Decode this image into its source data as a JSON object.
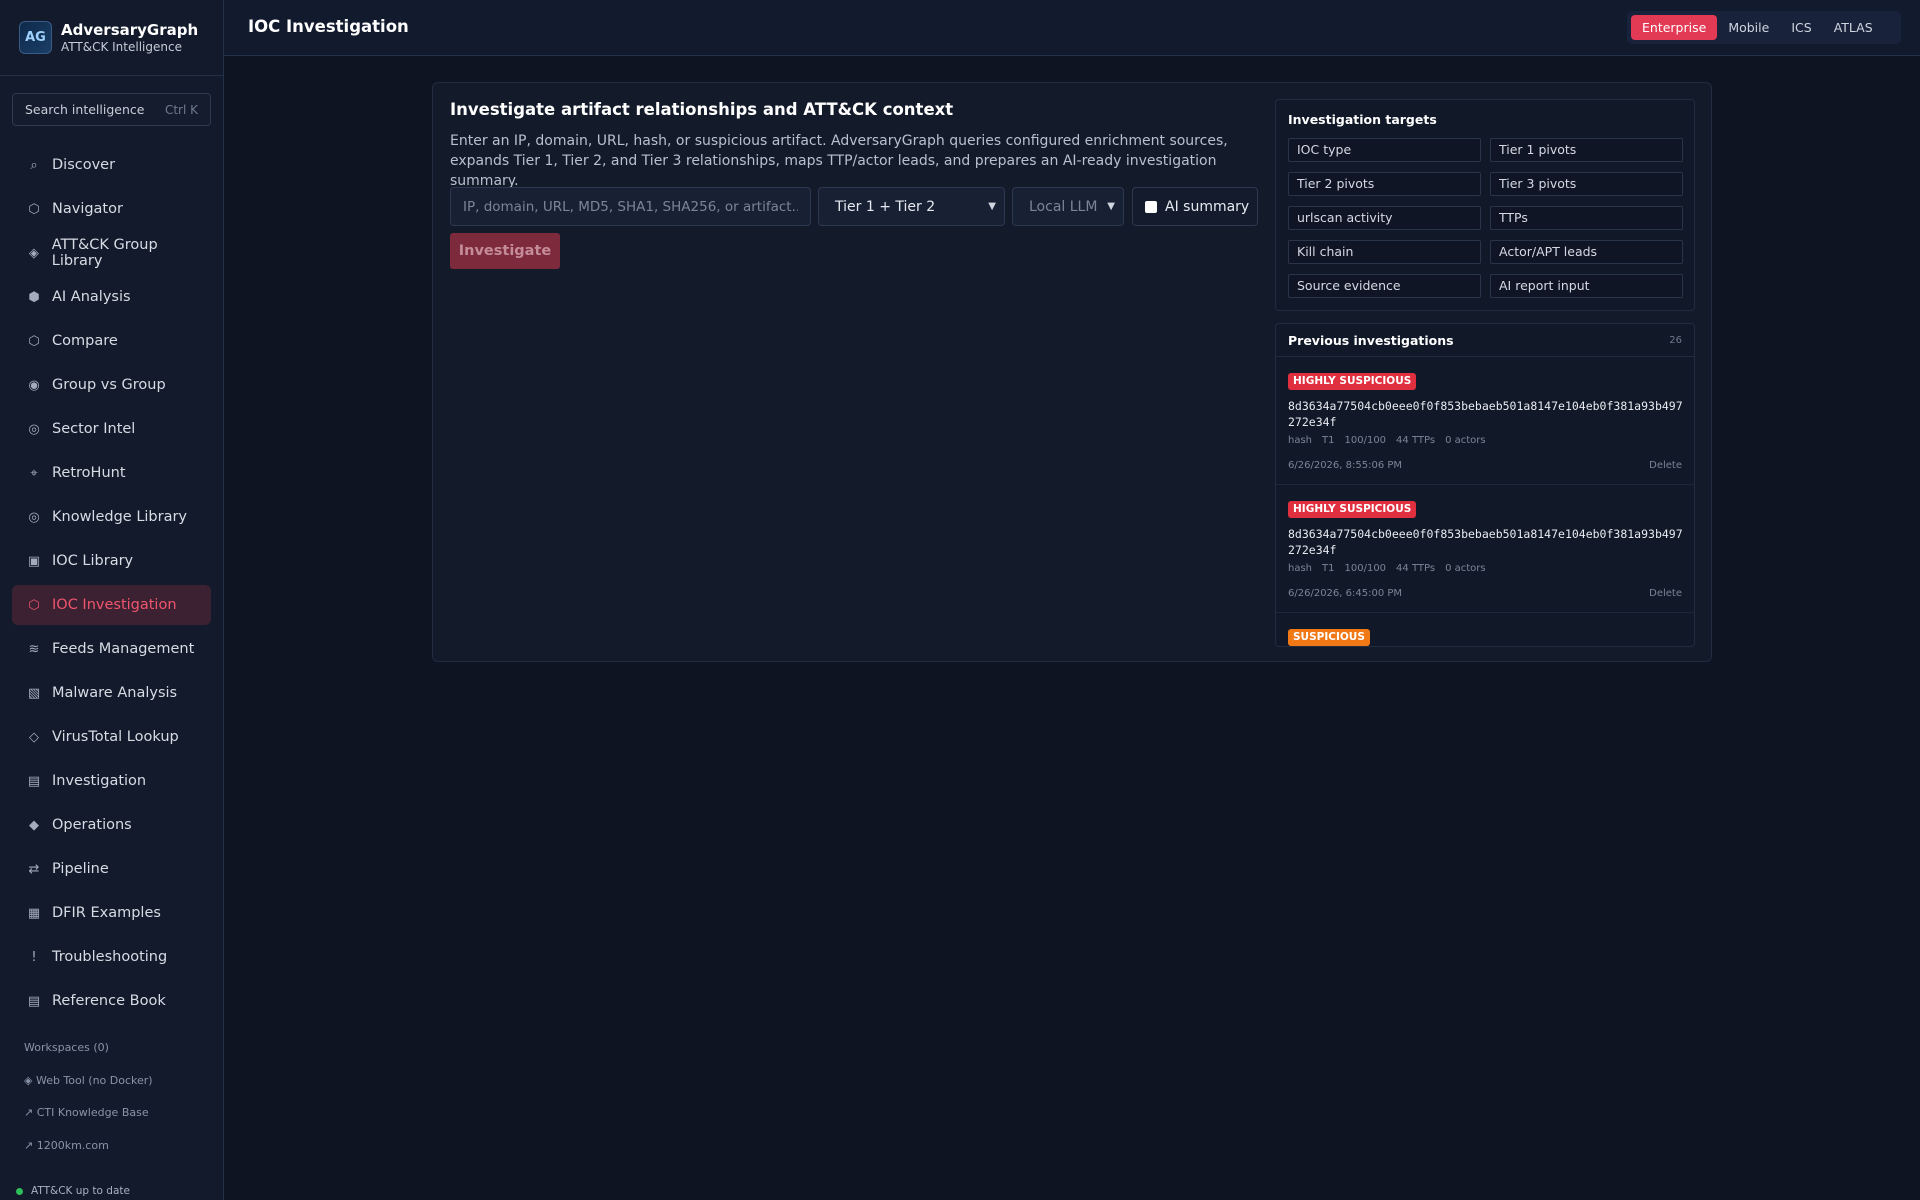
{
  "brand": {
    "logo": "AG",
    "name": "AdversaryGraph",
    "subtitle": "ATT&CK Intelligence"
  },
  "search": {
    "placeholder": "Search intelligence",
    "shortcut": "Ctrl K"
  },
  "nav": [
    {
      "label": "Discover",
      "icon": "⌕",
      "icon_name": "search-icon"
    },
    {
      "label": "Navigator",
      "icon": "⬡",
      "icon_name": "hexagon-icon"
    },
    {
      "label": "ATT&CK Group Library",
      "icon": "◈",
      "icon_name": "diamond-icon"
    },
    {
      "label": "AI Analysis",
      "icon": "⬢",
      "icon_name": "hexagon-filled-icon"
    },
    {
      "label": "Compare",
      "icon": "⬡",
      "icon_name": "hexagon-icon"
    },
    {
      "label": "Group vs Group",
      "icon": "◉",
      "icon_name": "target-icon"
    },
    {
      "label": "Sector Intel",
      "icon": "◎",
      "icon_name": "bullseye-icon"
    },
    {
      "label": "RetroHunt",
      "icon": "⌖",
      "icon_name": "crosshair-icon"
    },
    {
      "label": "Knowledge Library",
      "icon": "◎",
      "icon_name": "bullseye-icon"
    },
    {
      "label": "IOC Library",
      "icon": "▣",
      "icon_name": "square-icon"
    },
    {
      "label": "IOC Investigation",
      "icon": "⬡",
      "icon_name": "hexagon-icon",
      "active": true
    },
    {
      "label": "Feeds Management",
      "icon": "≋",
      "icon_name": "feed-icon"
    },
    {
      "label": "Malware Analysis",
      "icon": "▧",
      "icon_name": "grid-icon"
    },
    {
      "label": "VirusTotal Lookup",
      "icon": "◇",
      "icon_name": "diamond-outline-icon"
    },
    {
      "label": "Investigation",
      "icon": "▤",
      "icon_name": "list-icon"
    },
    {
      "label": "Operations",
      "icon": "◆",
      "icon_name": "diamond-filled-icon"
    },
    {
      "label": "Pipeline",
      "icon": "⇄",
      "icon_name": "pipeline-icon"
    },
    {
      "label": "DFIR Examples",
      "icon": "▦",
      "icon_name": "table-icon"
    },
    {
      "label": "Troubleshooting",
      "icon": "!",
      "icon_name": "alert-icon"
    },
    {
      "label": "Reference Book",
      "icon": "▤",
      "icon_name": "book-icon"
    }
  ],
  "side_links": [
    "Workspaces (0)",
    "◈ Web Tool (no Docker)",
    "↗ CTI Knowledge Base",
    "↗ 1200km.com"
  ],
  "status": {
    "text": "ATT&CK up to date",
    "color": "#2fbf5a"
  },
  "header": {
    "title": "IOC Investigation",
    "tabs": [
      "Enterprise",
      "Mobile",
      "ICS",
      "ATLAS"
    ],
    "active_tab": "Enterprise"
  },
  "main": {
    "title": "Investigate artifact relationships and ATT&CK context",
    "description": "Enter an IP, domain, URL, hash, or suspicious artifact. AdversaryGraph queries configured enrichment sources, expands Tier 1, Tier 2, and Tier 3 relationships, maps TTP/actor leads, and prepares an AI-ready investigation summary.",
    "input_placeholder": "IP, domain, URL, MD5, SHA1, SHA256, or artifact...",
    "tier_select": "Tier 1 + Tier 2",
    "llm_select": "Local LLM",
    "ai_summary_label": "AI summary",
    "button_label": "Investigate"
  },
  "targets": {
    "title": "Investigation targets",
    "items": [
      "IOC type",
      "Tier 1 pivots",
      "Tier 2 pivots",
      "Tier 3 pivots",
      "urlscan activity",
      "TTPs",
      "Kill chain",
      "Actor/APT leads",
      "Source evidence",
      "AI report input"
    ]
  },
  "previous": {
    "title": "Previous investigations",
    "count": "26",
    "items": [
      {
        "verdict": "HIGHLY SUSPICIOUS",
        "hash": "8d3634a77504cb0eee0f0f853bebaeb501a8147e104eb0f381a93b497272e34f",
        "type": "hash",
        "tier": "T1",
        "score": "100/100",
        "ttps": "44 TTPs",
        "actors": "0 actors",
        "timestamp": "6/26/2026, 8:55:06 PM",
        "delete_label": "Delete"
      },
      {
        "verdict": "HIGHLY SUSPICIOUS",
        "hash": "8d3634a77504cb0eee0f0f853bebaeb501a8147e104eb0f381a93b497272e34f",
        "type": "hash",
        "tier": "T1",
        "score": "100/100",
        "ttps": "44 TTPs",
        "actors": "0 actors",
        "timestamp": "6/26/2026, 6:45:00 PM",
        "delete_label": "Delete"
      },
      {
        "verdict": "SUSPICIOUS"
      }
    ]
  },
  "colors": {
    "accent": "#e23a55",
    "high": "#e02f3f",
    "suspicious": "#f07815"
  }
}
